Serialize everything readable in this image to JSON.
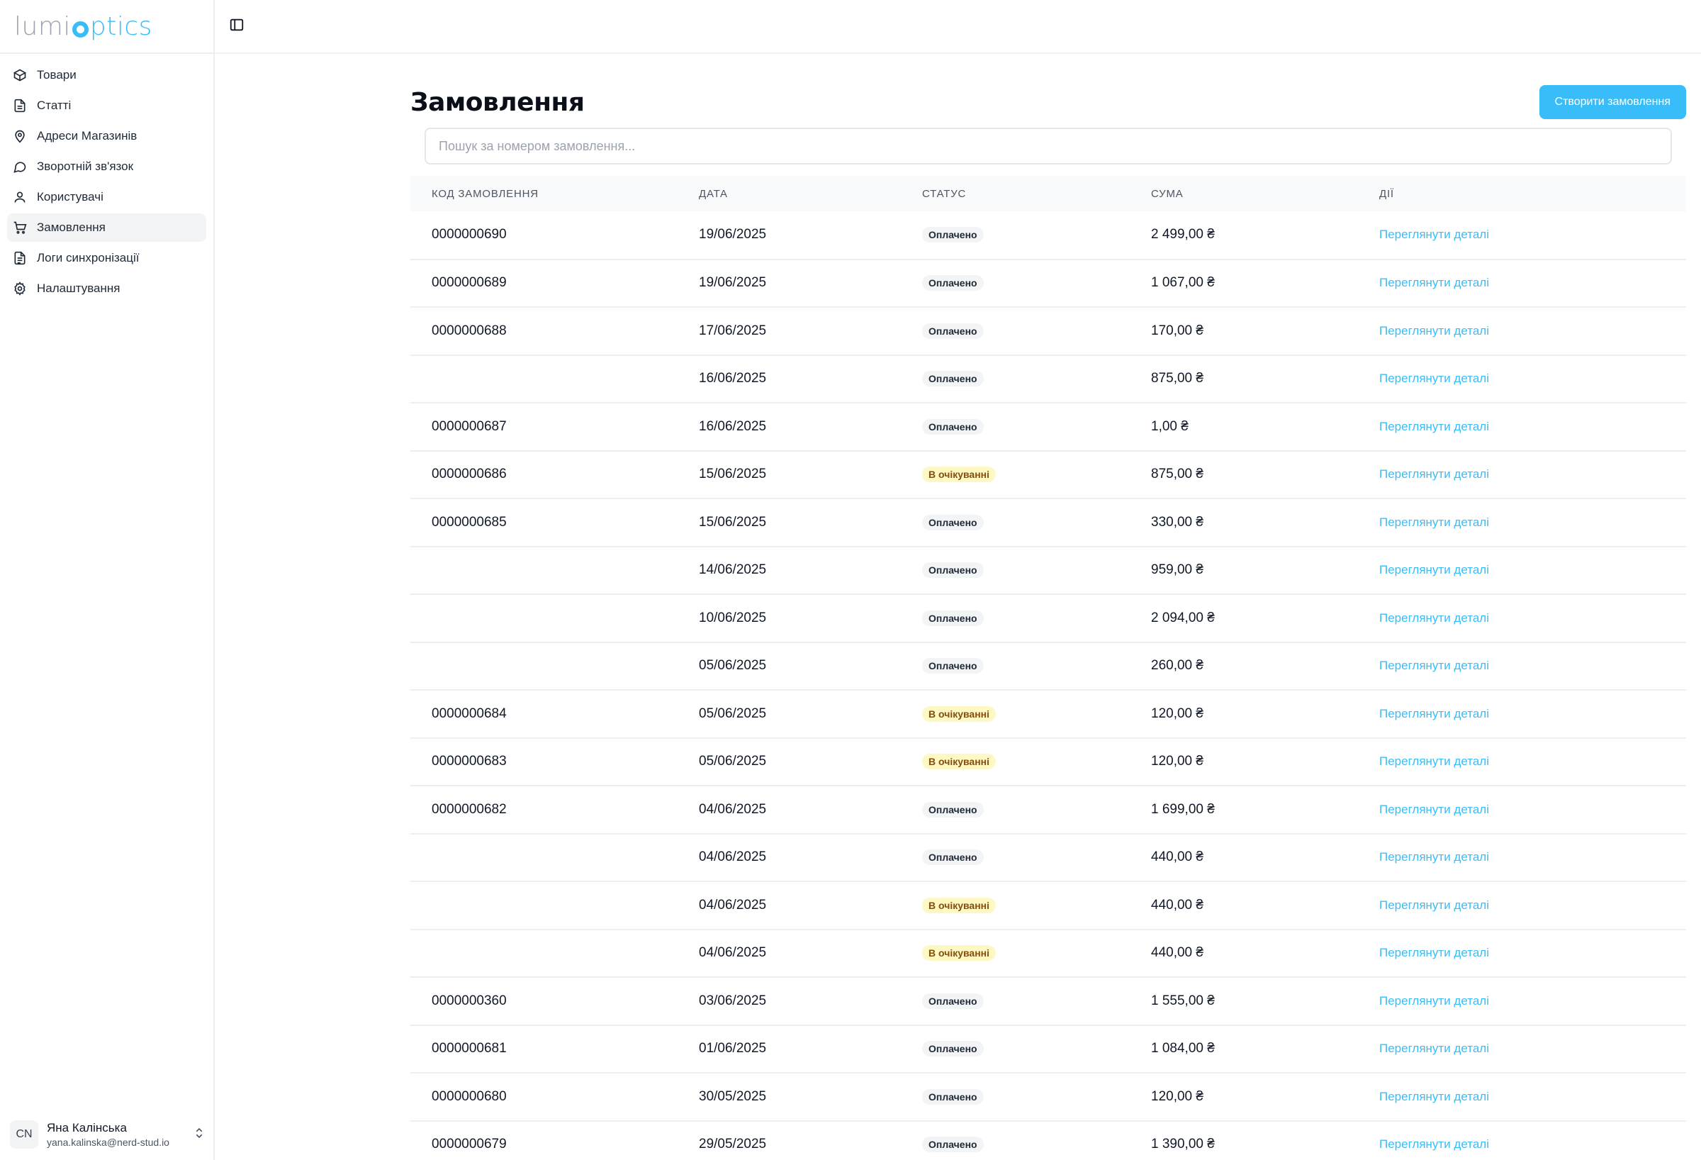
{
  "brand": {
    "lumi": "lumi",
    "optics": "ptics"
  },
  "sidebar": {
    "items": [
      {
        "label": "Товари",
        "icon": "box-icon"
      },
      {
        "label": "Статті",
        "icon": "document-icon"
      },
      {
        "label": "Адреси Магазинів",
        "icon": "map-pin-icon"
      },
      {
        "label": "Зворотній зв'язок",
        "icon": "chat-icon"
      },
      {
        "label": "Користувачі",
        "icon": "user-icon"
      },
      {
        "label": "Замовлення",
        "icon": "cart-icon",
        "active": true
      },
      {
        "label": "Логи синхронізації",
        "icon": "log-icon"
      },
      {
        "label": "Налаштування",
        "icon": "gear-icon"
      }
    ],
    "user": {
      "initials": "CN",
      "name": "Яна Калінська",
      "email": "yana.kalinska@nerd-stud.io"
    }
  },
  "page": {
    "title": "Замовлення",
    "create_button": "Створити замовлення",
    "search_placeholder": "Пошук за номером замовлення..."
  },
  "table": {
    "headers": [
      "Код замовлення",
      "Дата",
      "Статус",
      "Сума",
      "Дії"
    ],
    "action_label": "Переглянути деталі",
    "rows": [
      {
        "code": "0000000690",
        "date": "19/06/2025",
        "status": "Оплачено",
        "status_type": "paid",
        "sum": "2 499,00 ₴"
      },
      {
        "code": "0000000689",
        "date": "19/06/2025",
        "status": "Оплачено",
        "status_type": "paid",
        "sum": "1 067,00 ₴"
      },
      {
        "code": "0000000688",
        "date": "17/06/2025",
        "status": "Оплачено",
        "status_type": "paid",
        "sum": "170,00 ₴"
      },
      {
        "code": "",
        "date": "16/06/2025",
        "status": "Оплачено",
        "status_type": "paid",
        "sum": "875,00 ₴"
      },
      {
        "code": "0000000687",
        "date": "16/06/2025",
        "status": "Оплачено",
        "status_type": "paid",
        "sum": "1,00 ₴"
      },
      {
        "code": "0000000686",
        "date": "15/06/2025",
        "status": "В очікуванні",
        "status_type": "pending",
        "sum": "875,00 ₴"
      },
      {
        "code": "0000000685",
        "date": "15/06/2025",
        "status": "Оплачено",
        "status_type": "paid",
        "sum": "330,00 ₴"
      },
      {
        "code": "",
        "date": "14/06/2025",
        "status": "Оплачено",
        "status_type": "paid",
        "sum": "959,00 ₴"
      },
      {
        "code": "",
        "date": "10/06/2025",
        "status": "Оплачено",
        "status_type": "paid",
        "sum": "2 094,00 ₴"
      },
      {
        "code": "",
        "date": "05/06/2025",
        "status": "Оплачено",
        "status_type": "paid",
        "sum": "260,00 ₴"
      },
      {
        "code": "0000000684",
        "date": "05/06/2025",
        "status": "В очікуванні",
        "status_type": "pending",
        "sum": "120,00 ₴"
      },
      {
        "code": "0000000683",
        "date": "05/06/2025",
        "status": "В очікуванні",
        "status_type": "pending",
        "sum": "120,00 ₴"
      },
      {
        "code": "0000000682",
        "date": "04/06/2025",
        "status": "Оплачено",
        "status_type": "paid",
        "sum": "1 699,00 ₴"
      },
      {
        "code": "",
        "date": "04/06/2025",
        "status": "Оплачено",
        "status_type": "paid",
        "sum": "440,00 ₴"
      },
      {
        "code": "",
        "date": "04/06/2025",
        "status": "В очікуванні",
        "status_type": "pending",
        "sum": "440,00 ₴"
      },
      {
        "code": "",
        "date": "04/06/2025",
        "status": "В очікуванні",
        "status_type": "pending",
        "sum": "440,00 ₴"
      },
      {
        "code": "0000000360",
        "date": "03/06/2025",
        "status": "Оплачено",
        "status_type": "paid",
        "sum": "1 555,00 ₴"
      },
      {
        "code": "0000000681",
        "date": "01/06/2025",
        "status": "Оплачено",
        "status_type": "paid",
        "sum": "1 084,00 ₴"
      },
      {
        "code": "0000000680",
        "date": "30/05/2025",
        "status": "Оплачено",
        "status_type": "paid",
        "sum": "120,00 ₴"
      },
      {
        "code": "0000000679",
        "date": "29/05/2025",
        "status": "Оплачено",
        "status_type": "paid",
        "sum": "1 390,00 ₴"
      }
    ]
  },
  "colors": {
    "accent": "#38bdf8",
    "pending_bg": "#fef9c3",
    "paid_bg": "#f3f4f6"
  }
}
